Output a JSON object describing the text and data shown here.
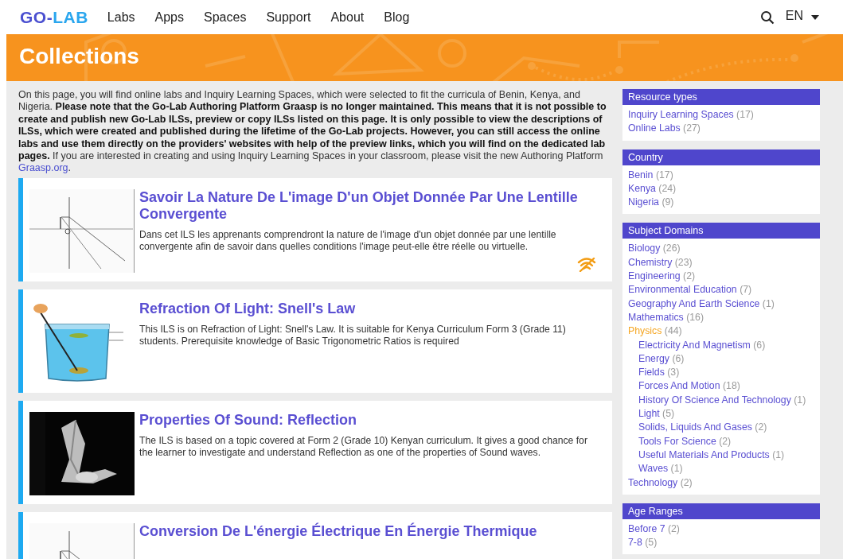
{
  "nav": {
    "logo": {
      "left": "GO-",
      "right": "LAB"
    },
    "links": [
      "Labs",
      "Apps",
      "Spaces",
      "Support",
      "About",
      "Blog"
    ],
    "language": "EN"
  },
  "banner": {
    "title": "Collections"
  },
  "intro": {
    "text": "On this page, you will find online labs and Inquiry Learning Spaces, which were selected to fit the curricula of Benin, Kenya, and Nigeria. **Please note that the Go-Lab Authoring Platform Graasp is no longer maintained. This means that it is not possible to create and publish new Go-Lab ILSs, preview or copy ILSs listed on this page. It is only possible to view the descriptions of ILSs, which were created and published during the lifetime of the Go-Lab projects. However, you can still access the online labs and use them directly on the providers' websites with help of the preview links, which you will find on the dedicated lab pages.** If you are interested in creating and using Inquiry Learning Spaces in your classroom, please visit the new Authoring Platform",
    "link": "Graasp.org",
    "after": "."
  },
  "cards": [
    {
      "title": "Savoir La Nature De L'image D'un Objet Donnée Par Une Lentille Convergente",
      "description": "Dans cet ILS les apprenants comprendront la nature de l'image d'un objet donnée par une lentille convergente afin de savoir dans quelles conditions l'image peut-elle être réelle ou virtuelle.",
      "offline": true
    },
    {
      "title": "Refraction Of Light: Snell's Law",
      "description": "This ILS is on Refraction of Light: Snell's Law. It is suitable for Kenya Curriculum Form 3 (Grade 11) students. Prerequisite knowledge of Basic Trigonometric Ratios is required",
      "offline": false
    },
    {
      "title": "Properties Of Sound: Reflection",
      "description": "The ILS is based on a topic covered at Form 2 (Grade 10) Kenyan curriculum. It gives a good chance for the learner to investigate and understand Reflection as one of the properties of Sound waves.",
      "offline": false
    },
    {
      "title": "Conversion De L'énergie Électrique En Énergie Thermique",
      "offline": false
    }
  ],
  "sidebar": [
    {
      "title": "Resource types",
      "items": [
        {
          "label": "Inquiry Learning Spaces",
          "count": "(17)",
          "selected": false
        },
        {
          "label": "Online Labs",
          "count": "(27)",
          "selected": false
        }
      ]
    },
    {
      "title": "Country",
      "items": [
        {
          "label": "Benin",
          "count": "(17)",
          "selected": false
        },
        {
          "label": "Kenya",
          "count": "(24)",
          "selected": false
        },
        {
          "label": "Nigeria",
          "count": "(9)",
          "selected": false
        }
      ]
    },
    {
      "title": "Subject Domains",
      "items": [
        {
          "label": "Biology",
          "count": "(26)",
          "selected": false
        },
        {
          "label": "Chemistry",
          "count": "(23)",
          "selected": false
        },
        {
          "label": "Engineering",
          "count": "(2)",
          "selected": false
        },
        {
          "label": "Environmental Education",
          "count": "(7)",
          "selected": false
        },
        {
          "label": "Geography And Earth Science",
          "count": "(1)",
          "selected": false
        },
        {
          "label": "Mathematics",
          "count": "(16)",
          "selected": false
        },
        {
          "label": "Physics",
          "count": "(44)",
          "selected": true,
          "children": [
            {
              "label": "Electricity And Magnetism",
              "count": "(6)",
              "selected": false
            },
            {
              "label": "Energy",
              "count": "(6)",
              "selected": false
            },
            {
              "label": "Fields",
              "count": "(3)",
              "selected": false
            },
            {
              "label": "Forces And Motion",
              "count": "(18)",
              "selected": false
            },
            {
              "label": "History Of Science And Technology",
              "count": "(1)",
              "selected": false
            },
            {
              "label": "Light",
              "count": "(5)",
              "selected": false
            },
            {
              "label": "Solids, Liquids And Gases",
              "count": "(2)",
              "selected": false
            },
            {
              "label": "Tools For Science",
              "count": "(2)",
              "selected": false
            },
            {
              "label": "Useful Materials And Products",
              "count": "(1)",
              "selected": false
            },
            {
              "label": "Waves",
              "count": "(1)",
              "selected": false
            }
          ]
        },
        {
          "label": "Technology",
          "count": "(2)",
          "selected": false
        }
      ]
    },
    {
      "title": "Age Ranges",
      "items": [
        {
          "label": "Before 7",
          "count": "(2)",
          "selected": false
        },
        {
          "label": "7-8",
          "count": "(5)",
          "selected": false
        }
      ]
    }
  ]
}
